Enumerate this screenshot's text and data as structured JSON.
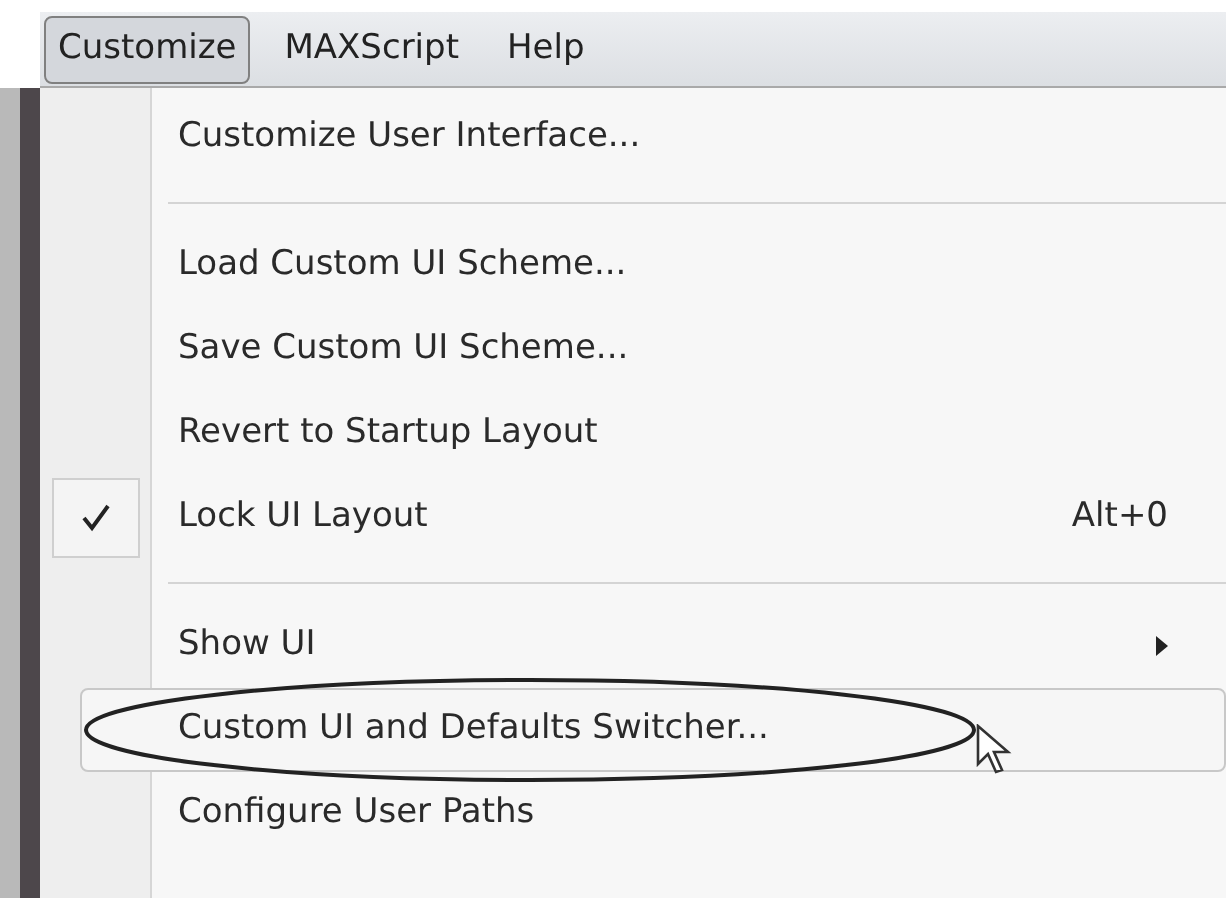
{
  "menu_bar": [
    {
      "label": "Customize",
      "selected": true
    },
    {
      "label": "MAXScript",
      "selected": false
    },
    {
      "label": "Help",
      "selected": false
    }
  ],
  "menu": [
    {
      "kind": "item",
      "label": "Customize User Interface...",
      "checked": false,
      "selected": false,
      "submenu": false
    },
    {
      "kind": "separator"
    },
    {
      "kind": "item",
      "label": "Load Custom UI Scheme...",
      "checked": false,
      "selected": false,
      "submenu": false
    },
    {
      "kind": "item",
      "label": "Save Custom UI Scheme...",
      "checked": false,
      "selected": false,
      "submenu": false
    },
    {
      "kind": "item",
      "label": "Revert to Startup Layout",
      "checked": false,
      "selected": false,
      "submenu": false
    },
    {
      "kind": "item",
      "label": "Lock UI Layout",
      "checked": true,
      "selected": false,
      "submenu": false,
      "shortcut": "Alt+0"
    },
    {
      "kind": "separator"
    },
    {
      "kind": "item",
      "label": "Show UI",
      "checked": false,
      "selected": false,
      "submenu": true
    },
    {
      "kind": "item",
      "label": "Custom UI and Defaults Switcher...",
      "checked": false,
      "selected": true,
      "submenu": false,
      "circled": true,
      "pointer": true
    },
    {
      "kind": "item",
      "label": "Configure User Paths",
      "checked": false,
      "selected": false,
      "submenu": false
    }
  ]
}
